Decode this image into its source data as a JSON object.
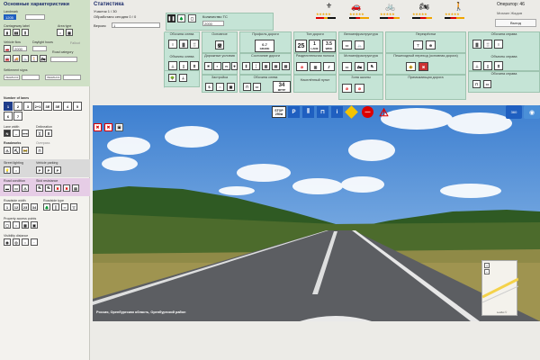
{
  "left": {
    "title": "Основные характеристики",
    "landmark_label": "Landmark",
    "landmark_value": "1205",
    "carriageway_label": "Carriageway label",
    "area_type_label": "Area type",
    "vehicle_flow_label": "Vehicle flow",
    "vehicle_flow_value": "2000",
    "daylight_hours_label": "Daylight hours",
    "daylight_value": "Fallout",
    "road_category_label": "Road category",
    "settlement_signs_label": "Settlement signs",
    "settlement_from": "ЛЕНИНСК",
    "settlement_to": "ЛЕНИНСК",
    "number_of_lanes_label": "Number of lanes",
    "lanes": [
      "1",
      "2",
      "3",
      "2+1",
      "3E",
      "3E",
      "4",
      "5",
      "6",
      "7"
    ],
    "lane_width_label": "Lane width",
    "delineation_label": "Delineation",
    "roadworks_label": "Roadworks",
    "overpass_label": "Overpass",
    "street_lighting_label": "Street lighting",
    "vehicle_parking_label": "Vehicle parking",
    "road_condition_label": "Road condition",
    "skid_resistance_label": "Skid resistance",
    "roadside_width_label": "Roadside width",
    "roadside_type_label": "Roadside type",
    "roadside_widths": [
      "1",
      "12",
      "23",
      "34"
    ],
    "property_access_label": "Property access points",
    "visibility_distance_label": "Visibility distance"
  },
  "top": {
    "stats_title": "Статистика",
    "section_text": "Участок 1 / 30",
    "processed_text": "Обработано сегодня 0 / 0",
    "version_label": "Версия",
    "version_value": "1",
    "count_label": "Количество ТС",
    "count_value": "2000",
    "operator_label": "Оператор: 46",
    "operator_name": "Михаил Жадов",
    "exit_label": "Выход"
  },
  "panel": {
    "groups": {
      "left_objects": "Обочина слева",
      "objects_left": "Объекты слева",
      "main": "Основное",
      "road_profile": "Профиль дороги",
      "road_types": "Тип дороги",
      "bike_infra": "Велоинфраструктура",
      "crossing": "Перекрёстки",
      "right_shoulder": "Обочина справа",
      "objects_right": "Объекты справа",
      "road_conditions": "Дорожные условия",
      "road_state": "Состояние дороги",
      "separator": "Разделительная полоса",
      "moto_infra": "Мотоинфраструктура",
      "ped_crossing": "Пешеходный переход (основная дорога)",
      "buildup": "Застройка",
      "left_shoulder_b": "Обочина слева",
      "right_shoulder_b": "Обочина справа",
      "settlement": "Населённый пункт",
      "school_zone": "Зона школы",
      "adjacent_road": "Примыкающая дорога"
    },
    "profile_value": "0-7",
    "profile_unit": "GRADE",
    "width_value": "25",
    "lanes_value": "1",
    "lane_label": "LANE",
    "wide_value": "3.5",
    "wide_unit": "WIDE",
    "speed_value": "34",
    "speed_unit": "МПТР"
  },
  "toolbar": {
    "stop_text": "STOP",
    "stop_dist": "250м"
  },
  "photo": {
    "caption": "Россия, Оренбургская область, Оренбургский район",
    "map_attrib": "Leaflet ©"
  },
  "colors": {
    "panel_green": "#c5e4d6",
    "left_green": "#cfe0c6",
    "left_pink": "#e6cde6",
    "sky": "#4a8fd8",
    "accent": "#1f3d8a"
  }
}
